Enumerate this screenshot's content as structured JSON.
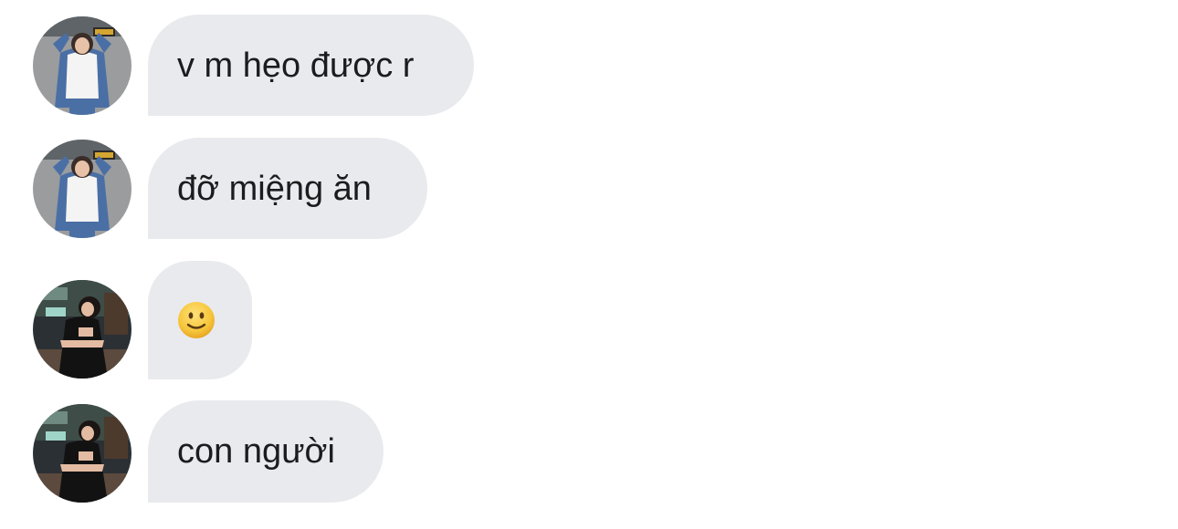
{
  "messages": [
    {
      "avatar": "avatar-denim-jacket",
      "text": "v m hẹo được r"
    },
    {
      "avatar": "avatar-denim-jacket",
      "text": "đỡ miệng ăn"
    },
    {
      "avatar": "avatar-black-dress",
      "text": "",
      "emoji": "slightly-smiling-face-icon"
    },
    {
      "avatar": "avatar-black-dress",
      "text": "con người"
    }
  ],
  "colors": {
    "bubble_bg": "#e9eaee",
    "text": "#1c1c1e",
    "emoji_yellow": "#f6c63b"
  }
}
